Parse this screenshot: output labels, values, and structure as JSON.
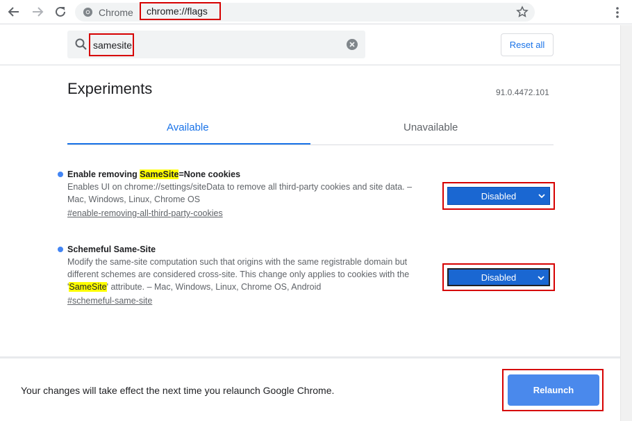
{
  "toolbar": {
    "site_name": "Chrome",
    "url": "chrome://flags"
  },
  "search": {
    "value": "samesite",
    "reset_label": "Reset all"
  },
  "page": {
    "title": "Experiments",
    "version": "91.0.4472.101",
    "tabs": [
      {
        "label": "Available",
        "active": true
      },
      {
        "label": "Unavailable",
        "active": false
      }
    ]
  },
  "flags": [
    {
      "title_pre": "Enable removing ",
      "title_hl": "SameSite",
      "title_post": "=None cookies",
      "desc_1": "Enables UI on chrome://settings/siteData to remove all third-party cookies and site data. – Mac, Windows, Linux, Chrome OS",
      "link": "#enable-removing-all-third-party-cookies",
      "selected": "Disabled"
    },
    {
      "title": "Schemeful Same-Site",
      "desc_pre": "Modify the same-site computation such that origins with the same registrable domain but different schemes are considered cross-site. This change only applies to cookies with the '",
      "desc_hl": "SameSite",
      "desc_post": "' attribute. – Mac, Windows, Linux, Chrome OS, Android",
      "link": "#schemeful-same-site",
      "selected": "Disabled"
    }
  ],
  "footer": {
    "message": "Your changes will take effect the next time you relaunch Google Chrome.",
    "relaunch_label": "Relaunch"
  },
  "colors": {
    "accent": "#1a73e8",
    "select_bg": "#1a67d2",
    "relaunch_bg": "#4a89ec",
    "highlight": "#ffff00",
    "annotation_red": "#d60000"
  }
}
